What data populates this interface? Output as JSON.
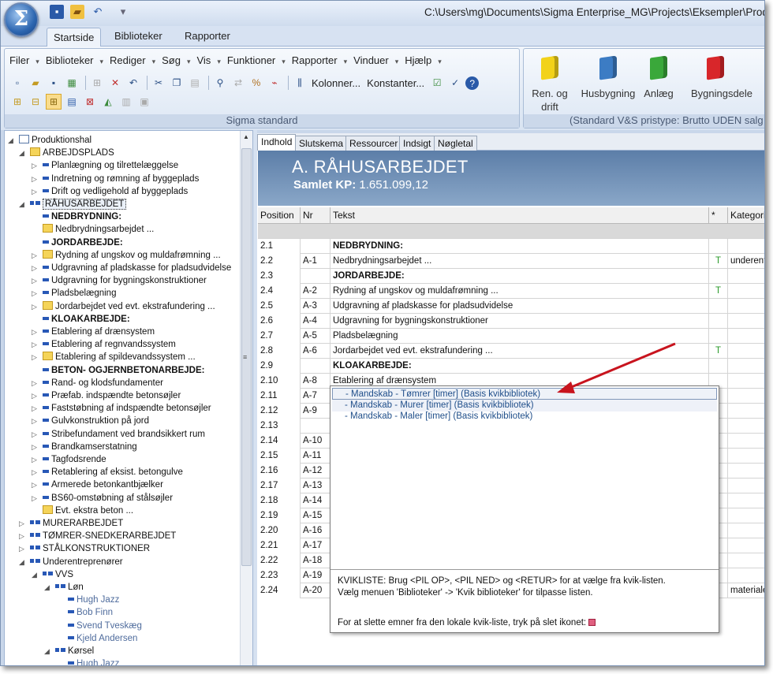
{
  "app": {
    "logo": "Σ",
    "window_title": "C:\\Users\\mg\\Documents\\Sigma Enterprise_MG\\Projects\\Eksempler\\Produ"
  },
  "ribbon_tabs": [
    "Startside",
    "Biblioteker",
    "Rapporter"
  ],
  "menu": [
    "Filer",
    "Biblioteker",
    "Rediger",
    "Søg",
    "Vis",
    "Funktioner",
    "Rapporter",
    "Vinduer",
    "Hjælp"
  ],
  "toolbar": {
    "kolonner": "Kolonner...",
    "konstanter": "Konstanter..."
  },
  "group1_label": "Sigma standard",
  "group2_label": "(Standard V&S pristype: Brutto UDEN salg",
  "libraries": [
    {
      "label1": "Ren. og",
      "label2": "drift",
      "color": "#f2d21a"
    },
    {
      "label1": "Husbygning",
      "label2": "",
      "color": "#3c7cc4"
    },
    {
      "label1": "Anlæg",
      "label2": "",
      "color": "#3aa83a"
    },
    {
      "label1": "Bygningsdele",
      "label2": "",
      "color": "#d8262a"
    }
  ],
  "tree": [
    {
      "label": "Produktionshal",
      "type": "doc",
      "toggle": "◢",
      "depth": 0
    },
    {
      "label": "ARBEJDSPLADS",
      "type": "folder",
      "toggle": "◢",
      "depth": 1
    },
    {
      "label": "Planlægning og tilrettelæggelse",
      "type": "blue",
      "toggle": "▷",
      "depth": 2
    },
    {
      "label": "Indretning og rømning af byggeplads",
      "type": "blue",
      "toggle": "▷",
      "depth": 2
    },
    {
      "label": "Drift og vedligehold af byggeplads",
      "type": "blue",
      "toggle": "▷",
      "depth": 2
    },
    {
      "label": "RÅHUSARBEJDET",
      "type": "multi",
      "toggle": "◢",
      "depth": 1,
      "sel": true
    },
    {
      "label": "NEDBRYDNING:",
      "type": "blue",
      "toggle": "",
      "depth": 2,
      "bold": true
    },
    {
      "label": "Nedbrydningsarbejdet ...",
      "type": "folder",
      "toggle": "",
      "depth": 2
    },
    {
      "label": "JORDARBEJDE:",
      "type": "blue",
      "toggle": "",
      "depth": 2,
      "bold": true
    },
    {
      "label": "Rydning af ungskov og muldafrømning ...",
      "type": "folder",
      "toggle": "▷",
      "depth": 2
    },
    {
      "label": "Udgravning af pladskasse for pladsudvidelse",
      "type": "blue",
      "toggle": "▷",
      "depth": 2
    },
    {
      "label": "Udgravning for bygningskonstruktioner",
      "type": "blue",
      "toggle": "▷",
      "depth": 2
    },
    {
      "label": "Pladsbelægning",
      "type": "blue",
      "toggle": "▷",
      "depth": 2
    },
    {
      "label": "Jordarbejdet ved evt. ekstrafundering ...",
      "type": "folder",
      "toggle": "▷",
      "depth": 2
    },
    {
      "label": "KLOAKARBEJDE:",
      "type": "blue",
      "toggle": "",
      "depth": 2,
      "bold": true
    },
    {
      "label": "Etablering af drænsystem",
      "type": "blue",
      "toggle": "▷",
      "depth": 2
    },
    {
      "label": "Etablering af regnvandssystem",
      "type": "blue",
      "toggle": "▷",
      "depth": 2
    },
    {
      "label": "Etablering af spildevandssystem ...",
      "type": "folder",
      "toggle": "▷",
      "depth": 2
    },
    {
      "label": "BETON- OGJERNBETONARBEJDE:",
      "type": "blue",
      "toggle": "",
      "depth": 2,
      "bold": true
    },
    {
      "label": "Rand- og klodsfundamenter",
      "type": "blue",
      "toggle": "▷",
      "depth": 2
    },
    {
      "label": "Præfab. indspændte betonsøjler",
      "type": "blue",
      "toggle": "▷",
      "depth": 2
    },
    {
      "label": "Faststøbning af indspændte betonsøjler",
      "type": "blue",
      "toggle": "▷",
      "depth": 2
    },
    {
      "label": "Gulvkonstruktion på jord",
      "type": "blue",
      "toggle": "▷",
      "depth": 2
    },
    {
      "label": "Stribefundament ved brandsikkert rum",
      "type": "blue",
      "toggle": "▷",
      "depth": 2
    },
    {
      "label": "Brandkamserstatning",
      "type": "blue",
      "toggle": "▷",
      "depth": 2
    },
    {
      "label": "Tagfodsrende",
      "type": "blue",
      "toggle": "▷",
      "depth": 2
    },
    {
      "label": "Retablering af eksist. betongulve",
      "type": "blue",
      "toggle": "▷",
      "depth": 2
    },
    {
      "label": "Armerede betonkantbjælker",
      "type": "blue",
      "toggle": "▷",
      "depth": 2
    },
    {
      "label": "BS60-omstøbning af stålsøjler",
      "type": "blue",
      "toggle": "▷",
      "depth": 2
    },
    {
      "label": "Evt. ekstra beton ...",
      "type": "folder",
      "toggle": "",
      "depth": 2
    },
    {
      "label": "MURERARBEJDET",
      "type": "multi",
      "toggle": "▷",
      "depth": 1
    },
    {
      "label": "TØMRER-SNEDKERARBEJDET",
      "type": "multi",
      "toggle": "▷",
      "depth": 1
    },
    {
      "label": "STÅLKONSTRUKTIONER",
      "type": "multi",
      "toggle": "▷",
      "depth": 1
    },
    {
      "label": "Underentreprenører",
      "type": "multi",
      "toggle": "◢",
      "depth": 1
    },
    {
      "label": "VVS",
      "type": "multi",
      "toggle": "◢",
      "depth": 2
    },
    {
      "label": "Løn",
      "type": "multi",
      "toggle": "◢",
      "depth": 3
    },
    {
      "label": "Hugh Jazz",
      "type": "blue",
      "toggle": "",
      "depth": 4,
      "grey": true
    },
    {
      "label": "Bob Finn",
      "type": "blue",
      "toggle": "",
      "depth": 4,
      "grey": true
    },
    {
      "label": "Svend Tveskæg",
      "type": "blue",
      "toggle": "",
      "depth": 4,
      "grey": true
    },
    {
      "label": "Kjeld Andersen",
      "type": "blue",
      "toggle": "",
      "depth": 4,
      "grey": true
    },
    {
      "label": "Kørsel",
      "type": "multi",
      "toggle": "◢",
      "depth": 3
    },
    {
      "label": "Hugh Jazz",
      "type": "blue",
      "toggle": "",
      "depth": 4,
      "grey": true
    }
  ],
  "doc_tabs": [
    "Indhold",
    "Slutskema",
    "Ressourcer",
    "Indsigt",
    "Nøgletal"
  ],
  "banner": {
    "title": "A. RÅHUSARBEJDET",
    "kp_label": "Samlet KP:",
    "kp_value": "1.651.099,12"
  },
  "grid_headers": [
    "Position",
    "Nr",
    "Tekst",
    "*",
    "Kategori"
  ],
  "rows": [
    {
      "pos": "2.1",
      "nr": "",
      "txt": "NEDBRYDNING:",
      "star": "",
      "kat": "",
      "bold": true
    },
    {
      "pos": "2.2",
      "nr": "A-1",
      "txt": "Nedbrydningsarbejdet ...",
      "star": "T",
      "kat": "underent",
      "bold": false
    },
    {
      "pos": "2.3",
      "nr": "",
      "txt": "JORDARBEJDE:",
      "star": "",
      "kat": "",
      "bold": true
    },
    {
      "pos": "2.4",
      "nr": "A-2",
      "txt": "Rydning af ungskov og muldafrømning ...",
      "star": "T",
      "kat": "",
      "bold": false
    },
    {
      "pos": "2.5",
      "nr": "A-3",
      "txt": "Udgravning af pladskasse for pladsudvidelse",
      "star": "",
      "kat": "",
      "bold": false
    },
    {
      "pos": "2.6",
      "nr": "A-4",
      "txt": "Udgravning for bygningskonstruktioner",
      "star": "",
      "kat": "",
      "bold": false
    },
    {
      "pos": "2.7",
      "nr": "A-5",
      "txt": "Pladsbelægning",
      "star": "",
      "kat": "",
      "bold": false
    },
    {
      "pos": "2.8",
      "nr": "A-6",
      "txt": "Jordarbejdet ved evt. ekstrafundering ...",
      "star": "T",
      "kat": "",
      "bold": false
    },
    {
      "pos": "2.9",
      "nr": "",
      "txt": "KLOAKARBEJDE:",
      "star": "",
      "kat": "",
      "bold": true
    },
    {
      "pos": "2.10",
      "nr": "A-8",
      "txt": "Etablering af drænsystem",
      "star": "",
      "kat": "",
      "bold": false
    },
    {
      "pos": "2.11",
      "nr": "A-7",
      "txt": "",
      "star": "",
      "kat": "",
      "bold": false
    },
    {
      "pos": "2.12",
      "nr": "A-9",
      "txt": "",
      "star": "",
      "kat": "",
      "bold": false
    },
    {
      "pos": "2.13",
      "nr": "",
      "txt": "",
      "star": "",
      "kat": "",
      "bold": false
    },
    {
      "pos": "2.14",
      "nr": "A-10",
      "txt": "",
      "star": "",
      "kat": "",
      "bold": false
    },
    {
      "pos": "2.15",
      "nr": "A-11",
      "txt": "",
      "star": "",
      "kat": "",
      "bold": false
    },
    {
      "pos": "2.16",
      "nr": "A-12",
      "txt": "",
      "star": "",
      "kat": "",
      "bold": false
    },
    {
      "pos": "2.17",
      "nr": "A-13",
      "txt": "",
      "star": "",
      "kat": "",
      "bold": false
    },
    {
      "pos": "2.18",
      "nr": "A-14",
      "txt": "",
      "star": "",
      "kat": "",
      "bold": false
    },
    {
      "pos": "2.19",
      "nr": "A-15",
      "txt": "",
      "star": "",
      "kat": "",
      "bold": false
    },
    {
      "pos": "2.20",
      "nr": "A-16",
      "txt": "",
      "star": "",
      "kat": "",
      "bold": false
    },
    {
      "pos": "2.21",
      "nr": "A-17",
      "txt": "",
      "star": "",
      "kat": "",
      "bold": false
    },
    {
      "pos": "2.22",
      "nr": "A-18",
      "txt": "",
      "star": "",
      "kat": "",
      "bold": false
    },
    {
      "pos": "2.23",
      "nr": "A-19",
      "txt": "",
      "star": "",
      "kat": "",
      "bold": false
    },
    {
      "pos": "2.24",
      "nr": "A-20",
      "txt": "",
      "star": "",
      "kat": "materiale",
      "bold": false
    }
  ],
  "popup": {
    "items": [
      "- Mandskab - Tømrer [timer] (Basis kvikbibliotek)",
      "- Mandskab - Murer [timer] (Basis kvikbibliotek)",
      "- Mandskab - Maler [timer] (Basis kvikbibliotek)"
    ],
    "help1": "KVIKLISTE: Brug <PIL OP>, <PIL NED> og <RETUR> for at vælge fra kvik-listen.",
    "help2": "Vælg menuen 'Biblioteker' -> 'Kvik biblioteker' for tilpasse listen.",
    "help3": "For at slette emner fra den lokale kvik-liste, tryk på slet ikonet:"
  },
  "colors": {
    "accent_arrow": "#c8141e",
    "banner": "#6f8fb6",
    "selection": "#f9dc8c"
  }
}
